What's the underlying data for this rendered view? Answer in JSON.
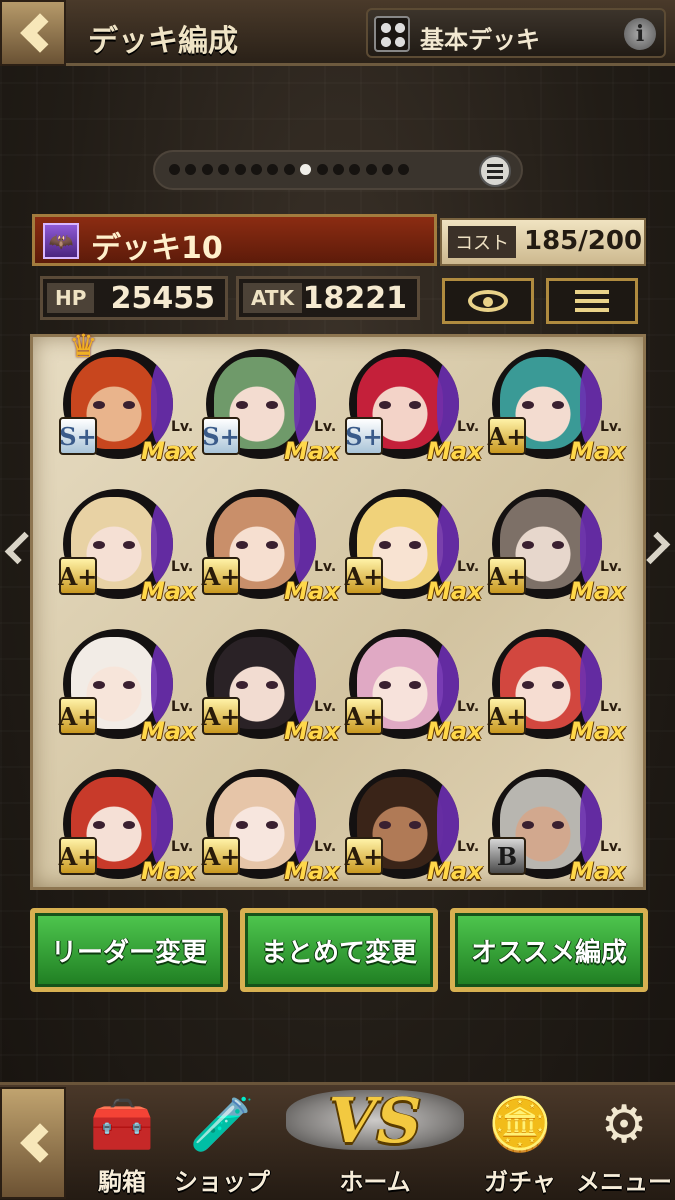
{
  "header": {
    "title": "デッキ編成",
    "deck_preset": "基本デッキ",
    "info_icon": "i"
  },
  "pager": {
    "total": 15,
    "active_index": 8
  },
  "deck": {
    "name": "デッキ10",
    "cost_label": "コスト",
    "cost_value": "185/200",
    "hp_label": "HP",
    "hp_value": "25455",
    "atk_label": "ATK",
    "atk_value": "18221"
  },
  "cards": [
    {
      "rank": "S+",
      "rank_style": "silver",
      "lv": "Lv.",
      "level": "Max",
      "hair": "#c8461e",
      "skin": "#e9b48c",
      "leader": true
    },
    {
      "rank": "S+",
      "rank_style": "silver",
      "lv": "Lv.",
      "level": "Max",
      "hair": "#6f9a6a",
      "skin": "#f3dcd0",
      "leader": false
    },
    {
      "rank": "S+",
      "rank_style": "silver",
      "lv": "Lv.",
      "level": "Max",
      "hair": "#c4203a",
      "skin": "#f3d3c8",
      "leader": false
    },
    {
      "rank": "A+",
      "rank_style": "gold",
      "lv": "Lv.",
      "level": "Max",
      "hair": "#3a9a96",
      "skin": "#f3dcd0",
      "leader": false
    },
    {
      "rank": "A+",
      "rank_style": "gold",
      "lv": "Lv.",
      "level": "Max",
      "hair": "#e8d2a4",
      "skin": "#f5e0d4",
      "leader": false
    },
    {
      "rank": "A+",
      "rank_style": "gold",
      "lv": "Lv.",
      "level": "Max",
      "hair": "#c98f6a",
      "skin": "#f6dfd0",
      "leader": false
    },
    {
      "rank": "A+",
      "rank_style": "gold",
      "lv": "Lv.",
      "level": "Max",
      "hair": "#f0d27a",
      "skin": "#f8e3d2",
      "leader": false
    },
    {
      "rank": "A+",
      "rank_style": "gold",
      "lv": "Lv.",
      "level": "Max",
      "hair": "#7d7067",
      "skin": "#e7d7cc",
      "leader": false
    },
    {
      "rank": "A+",
      "rank_style": "gold",
      "lv": "Lv.",
      "level": "Max",
      "hair": "#f2ece6",
      "skin": "#f7e5da",
      "leader": false
    },
    {
      "rank": "A+",
      "rank_style": "gold",
      "lv": "Lv.",
      "level": "Max",
      "hair": "#2a2226",
      "skin": "#f2dcd1",
      "leader": false
    },
    {
      "rank": "A+",
      "rank_style": "gold",
      "lv": "Lv.",
      "level": "Max",
      "hair": "#e0a9c4",
      "skin": "#f7e2db",
      "leader": false
    },
    {
      "rank": "A+",
      "rank_style": "gold",
      "lv": "Lv.",
      "level": "Max",
      "hair": "#d2473f",
      "skin": "#f6ddd2",
      "leader": false
    },
    {
      "rank": "A+",
      "rank_style": "gold",
      "lv": "Lv.",
      "level": "Max",
      "hair": "#c83a2a",
      "skin": "#f5e0d6",
      "leader": false
    },
    {
      "rank": "A+",
      "rank_style": "gold",
      "lv": "Lv.",
      "level": "Max",
      "hair": "#e6c5a8",
      "skin": "#f7e6de",
      "leader": false
    },
    {
      "rank": "A+",
      "rank_style": "gold",
      "lv": "Lv.",
      "level": "Max",
      "hair": "#3a2418",
      "skin": "#b07a56",
      "leader": false
    },
    {
      "rank": "B",
      "rank_style": "bronze",
      "lv": "Lv.",
      "level": "Max",
      "hair": "#b8b6b0",
      "skin": "#d2a88e",
      "leader": false
    }
  ],
  "actions": {
    "leader_change": "リーダー変更",
    "bulk_change": "まとめて変更",
    "recommend": "オススメ編成"
  },
  "nav": {
    "box": "駒箱",
    "shop": "ショップ",
    "vs": "VS",
    "home": "ホーム",
    "gacha": "ガチャ",
    "menu": "メニュー"
  },
  "icons": {
    "back": "chevron-left-icon",
    "deck_preset": "grid-icon",
    "info": "info-icon",
    "list": "list-icon",
    "eye": "eye-icon",
    "menu": "hamburger-icon",
    "crown": "crown-icon",
    "box": "treasure-chest-icon",
    "shop": "potion-icon",
    "gacha": "coins-icon",
    "settings": "gears-icon"
  },
  "colors": {
    "accent_gold": "#d7b051",
    "button_green": "#3fb040",
    "deck_bar_red": "#8c2c12"
  }
}
